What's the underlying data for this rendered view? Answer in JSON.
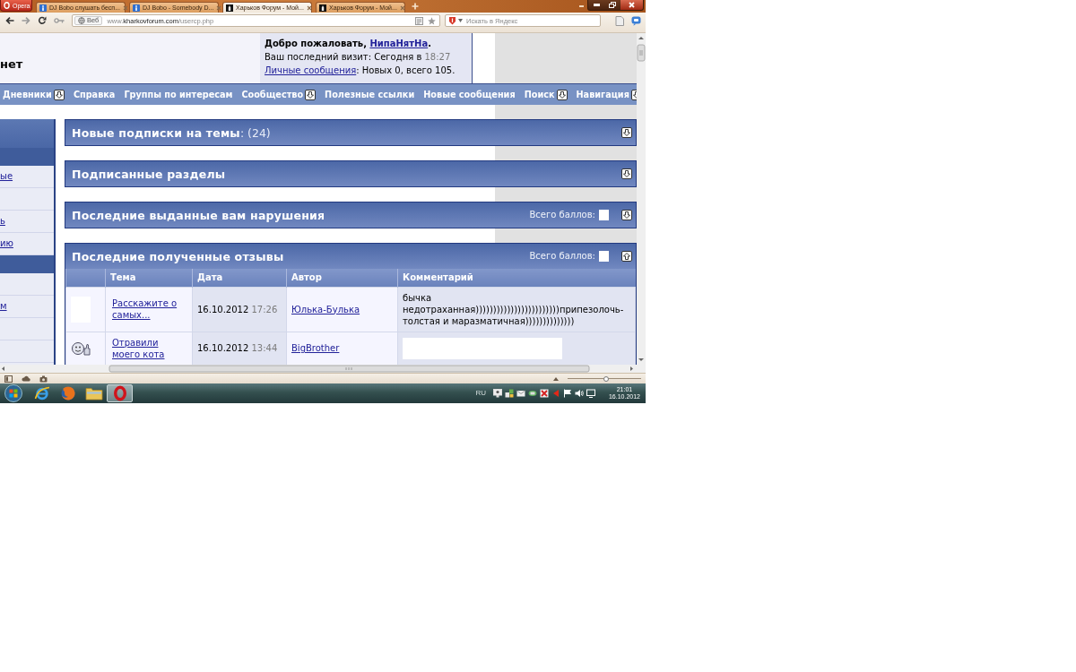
{
  "browser": {
    "menu_button": "Opera",
    "tabs": [
      {
        "label": "DJ Bobo слушать бесп...",
        "kind": "info",
        "selected": false
      },
      {
        "label": "DJ Bobo - Somebody D...",
        "kind": "info",
        "selected": false
      },
      {
        "label": "Харьков Форум - Мой...",
        "kind": "forum",
        "selected": true
      },
      {
        "label": "Харьков Форум - Мой...",
        "kind": "forum",
        "selected": false
      }
    ],
    "address": {
      "badge": "Веб",
      "url": "www.**kharkovforum.com**/usercp.php"
    },
    "search": {
      "placeholder": "Искать в Яндекс"
    },
    "zoom_slider": {
      "level": 0.52
    }
  },
  "page": {
    "header": {
      "title": "нет",
      "welcome": {
        "greeting": "Добро пожаловать,",
        "username": "НипаНятНа",
        "greeting_end": "."
      },
      "last_visit": {
        "label": "Ваш последний визит: Сегодня в",
        "time": "18:27"
      },
      "messages": {
        "link": "Личные сообщения",
        "text": ": Новых 0, всего 105."
      }
    },
    "nav": [
      {
        "label": "Дневники",
        "dropdown": true
      },
      {
        "label": "Справка",
        "dropdown": false
      },
      {
        "label": "Группы по интересам",
        "dropdown": false
      },
      {
        "label": "Сообщество",
        "dropdown": true
      },
      {
        "label": "Полезные ссылки",
        "dropdown": false
      },
      {
        "label": "Новые сообщения",
        "dropdown": false
      },
      {
        "label": "Поиск",
        "dropdown": true
      },
      {
        "label": "Навигация",
        "dropdown": true
      }
    ],
    "sidebar": [
      {
        "kind": "header"
      },
      {
        "kind": "band"
      },
      {
        "kind": "link",
        "label": "ые"
      },
      {
        "kind": "empty"
      },
      {
        "kind": "link",
        "label": "ь"
      },
      {
        "kind": "link",
        "label": "ию"
      },
      {
        "kind": "band"
      },
      {
        "kind": "empty"
      },
      {
        "kind": "link",
        "label": "м"
      },
      {
        "kind": "empty"
      },
      {
        "kind": "empty"
      }
    ],
    "sections": [
      {
        "title": "Новые подписки на темы",
        "count": ": (24)",
        "expanded": false
      },
      {
        "title": "Подписанные разделы",
        "expanded": false
      },
      {
        "title": "Последние выданные вам нарушения",
        "points": {
          "label": "Всего баллов:",
          "value_hidden": true
        },
        "expanded": false
      },
      {
        "title": "Последние полученные отзывы",
        "points": {
          "label": "Всего баллов:",
          "value_hidden": true
        },
        "expanded": true,
        "table": {
          "columns": [
            "Тема",
            "Дата",
            "Автор",
            "Комментарий"
          ],
          "rows": [
            {
              "kind": "hidden",
              "topic": "Расскажите о самых...",
              "date": "16.10.2012",
              "time": "17:26",
              "author": "Юлька-Булька",
              "comment": "бычка недотраханная))))))))))))))))))))))))припезолочь-толстая и маразматичная))))))))))))))",
              "comment_hidden": false
            },
            {
              "kind": "thumbs_up",
              "topic": "Отравили моего кота",
              "date": "16.10.2012",
              "time": "13:44",
              "author": "BigBrother",
              "comment_hidden": true
            }
          ]
        }
      }
    ]
  },
  "taskbar": {
    "apps": [
      {
        "kind": "ie",
        "active": false
      },
      {
        "kind": "firefox",
        "active": false
      },
      {
        "kind": "explorer",
        "active": false
      },
      {
        "kind": "opera",
        "active": true
      }
    ],
    "language": "RU",
    "time": "21:01",
    "date": "16.10.2012"
  }
}
